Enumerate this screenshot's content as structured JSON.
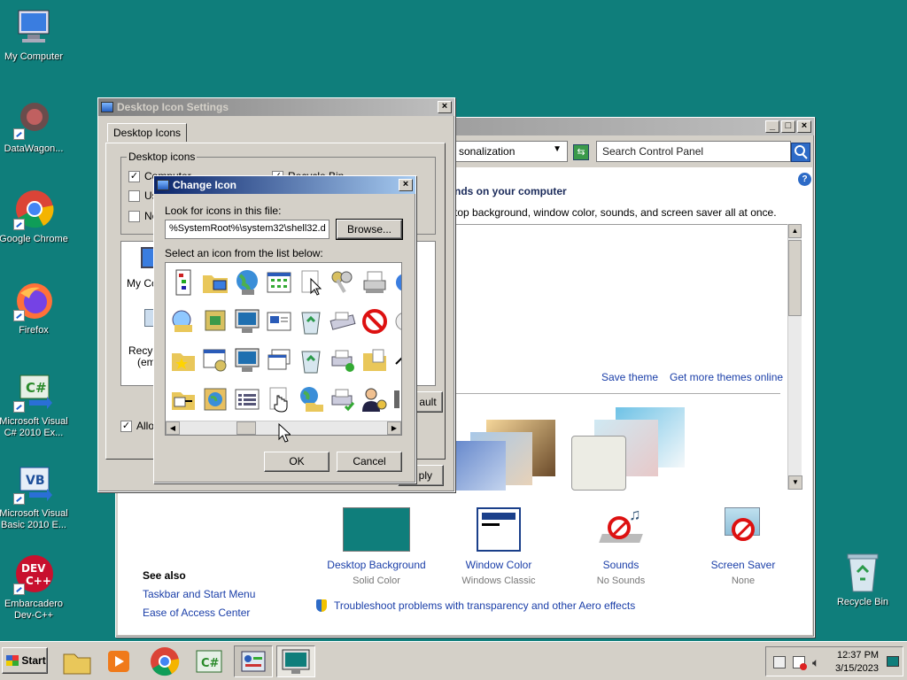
{
  "desktop": {
    "icons": [
      {
        "label": "My Computer",
        "icon": "computer-icon"
      },
      {
        "label": "DataWagon...",
        "icon": "datawagon-icon"
      },
      {
        "label": "Google Chrome",
        "icon": "chrome-icon"
      },
      {
        "label": "Firefox",
        "icon": "firefox-icon"
      },
      {
        "label": "Microsoft Visual C# 2010 Ex...",
        "icon": "visual-csharp-icon"
      },
      {
        "label": "Microsoft Visual Basic 2010 E...",
        "icon": "visual-basic-icon"
      },
      {
        "label": "Embarcadero Dev-C++",
        "icon": "devcpp-icon"
      },
      {
        "label": "Recycle Bin",
        "icon": "recycle-bin-icon"
      }
    ]
  },
  "personalization": {
    "address": "sonalization",
    "search_placeholder": "Search Control Panel",
    "heading": "nds on your computer",
    "description": "top background, window color, sounds, and screen saver all at once.",
    "save_theme": "Save theme",
    "get_more_themes": "Get more themes online",
    "items": [
      {
        "name": "Desktop Background",
        "value": "Solid Color"
      },
      {
        "name": "Window Color",
        "value": "Windows Classic"
      },
      {
        "name": "Sounds",
        "value": "No Sounds"
      },
      {
        "name": "Screen Saver",
        "value": "None"
      }
    ],
    "see_also": {
      "title": "See also",
      "links": [
        "Taskbar and Start Menu",
        "Ease of Access Center"
      ]
    },
    "troubleshoot": "Troubleshoot problems with transparency and other Aero effects"
  },
  "desktop_icon_settings": {
    "title": "Desktop Icon Settings",
    "tab": "Desktop Icons",
    "group": "Desktop icons",
    "checkboxes": [
      {
        "label": "Computer",
        "checked": true
      },
      {
        "label": "Us",
        "checked": false
      },
      {
        "label": "Ne",
        "checked": false
      },
      {
        "label": "Recycle Bin",
        "checked": true
      }
    ],
    "preview_labels": [
      "My Co",
      "Recyc",
      "(emp"
    ],
    "allow_label": "Allow",
    "default_partial": "ault",
    "apply_partial": "ply"
  },
  "change_icon": {
    "title": "Change Icon",
    "look_label": "Look for icons in this file:",
    "file_value": "%SystemRoot%\\system32\\shell32.d",
    "browse": "Browse...",
    "select_label": "Select an icon from the list below:",
    "ok": "OK",
    "cancel": "Cancel"
  },
  "taskbar": {
    "start": "Start",
    "time": "12:37 PM",
    "date": "3/15/2023"
  },
  "colors": {
    "desktop": "#0f7e7b",
    "titlebar_active": "#0a246a",
    "link": "#1a3ea8"
  }
}
